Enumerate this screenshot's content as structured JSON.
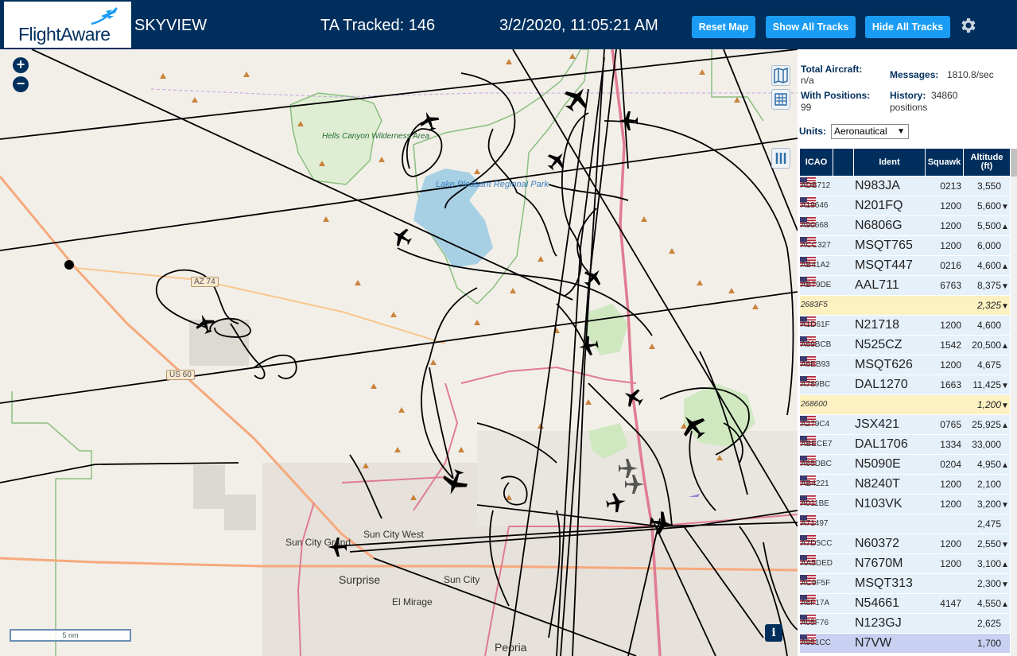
{
  "header": {
    "logo_text": "FlightAware",
    "app_title": "SKYVIEW",
    "tracked": "TA Tracked: 146",
    "datetime": "3/2/2020, 11:05:21 AM",
    "reset_label": "Reset Map",
    "show_label": "Show All Tracks",
    "hide_label": "Hide All Tracks",
    "settings_icon": "gear-icon"
  },
  "map": {
    "zoom_in": "+",
    "zoom_out": "−",
    "scale_label": "5 nm",
    "info_label": "i",
    "place_labels": {
      "hells_canyon": "Hells Canyon Wilderness Area",
      "lake_pleasant": "Lake Pleasant Regional Park",
      "sun_city_west": "Sun City West",
      "sun_city_grand": "Sun City Grand",
      "surprise": "Surprise",
      "sun_city": "Sun City",
      "el_mirage": "El Mirage",
      "peoria": "Peoria"
    },
    "road_shields": {
      "az74": "AZ 74",
      "us60": "US 60"
    },
    "colors": {
      "land": "#f2efe9",
      "water": "#a7d0e4",
      "park_border": "#8bbf80",
      "highway": "#e07c93",
      "track": "#000000"
    }
  },
  "panel": {
    "total_aircraft_label": "Total Aircraft:",
    "total_aircraft_value": "n/a",
    "messages_label": "Messages:",
    "messages_value": "1810.8/sec",
    "with_positions_label": "With Positions:",
    "with_positions_value": "99",
    "history_label": "History:",
    "history_value": "34860",
    "history_unit": "positions",
    "units_label": "Units:",
    "units_value": "Aeronautical",
    "columns": [
      "ICAO",
      "",
      "Ident",
      "Squawk",
      "Altitude (ft)"
    ],
    "rows": [
      {
        "icao": "ADB712",
        "ident": "N983JA",
        "squawk": "0213",
        "alt": "3,550",
        "trend": "",
        "flag": true,
        "state": ""
      },
      {
        "icao": "A19646",
        "ident": "N201FQ",
        "squawk": "1200",
        "alt": "5,600",
        "trend": "▼",
        "flag": true,
        "state": ""
      },
      {
        "icao": "A90668",
        "ident": "N6806G",
        "squawk": "1200",
        "alt": "5,500",
        "trend": "▲",
        "flag": true,
        "state": ""
      },
      {
        "icao": "ACC327",
        "ident": "MSQT765",
        "squawk": "1200",
        "alt": "6,000",
        "trend": "",
        "flag": true,
        "state": ""
      },
      {
        "icao": "AB41A2",
        "ident": "MSQT447",
        "squawk": "0216",
        "alt": "4,600",
        "trend": "▲",
        "flag": true,
        "state": ""
      },
      {
        "icao": "AB79DE",
        "ident": "AAL711",
        "squawk": "6763",
        "alt": "8,375",
        "trend": "▼",
        "flag": true,
        "state": ""
      },
      {
        "icao": "2683F5",
        "ident": "",
        "squawk": "",
        "alt": "2,325",
        "trend": "▼",
        "flag": false,
        "state": "sel"
      },
      {
        "icao": "A1D61F",
        "ident": "N21718",
        "squawk": "1200",
        "alt": "4,600",
        "trend": "",
        "flag": true,
        "state": ""
      },
      {
        "icao": "A69BCB",
        "ident": "N525CZ",
        "squawk": "1542",
        "alt": "20,500",
        "trend": "▲",
        "flag": true,
        "state": ""
      },
      {
        "icao": "A6EB93",
        "ident": "MSQT626",
        "squawk": "1200",
        "alt": "4,675",
        "trend": "",
        "flag": true,
        "state": ""
      },
      {
        "icao": "A789BC",
        "ident": "DAL1270",
        "squawk": "1663",
        "alt": "11,425",
        "trend": "▼",
        "flag": true,
        "state": ""
      },
      {
        "icao": "268600",
        "ident": "",
        "squawk": "",
        "alt": "1,200",
        "trend": "▼",
        "flag": false,
        "state": "sel"
      },
      {
        "icao": "A279C4",
        "ident": "JSX421",
        "squawk": "0765",
        "alt": "25,925",
        "trend": "▲",
        "flag": true,
        "state": ""
      },
      {
        "icao": "ABECE7",
        "ident": "DAL1706",
        "squawk": "1334",
        "alt": "33,000",
        "trend": "",
        "flag": true,
        "state": ""
      },
      {
        "icao": "A65DBC",
        "ident": "N5090E",
        "squawk": "0204",
        "alt": "4,950",
        "trend": "▲",
        "flag": true,
        "state": ""
      },
      {
        "icao": "AB4221",
        "ident": "N8240T",
        "squawk": "1200",
        "alt": "2,100",
        "trend": "",
        "flag": true,
        "state": ""
      },
      {
        "icao": "A011BE",
        "ident": "N103VK",
        "squawk": "1200",
        "alt": "3,200",
        "trend": "▼",
        "flag": true,
        "state": ""
      },
      {
        "icao": "A71497",
        "ident": "",
        "squawk": "",
        "alt": "2,475",
        "trend": "",
        "flag": true,
        "state": ""
      },
      {
        "icao": "A7D5CC",
        "ident": "N60372",
        "squawk": "1200",
        "alt": "2,550",
        "trend": "▼",
        "flag": true,
        "state": ""
      },
      {
        "icao": "AA5DED",
        "ident": "N7670M",
        "squawk": "1200",
        "alt": "3,100",
        "trend": "▲",
        "flag": true,
        "state": ""
      },
      {
        "icao": "AC9F5F",
        "ident": "MSQT313",
        "squawk": "",
        "alt": "2,300",
        "trend": "▼",
        "flag": true,
        "state": ""
      },
      {
        "icao": "A6F17A",
        "ident": "N54661",
        "squawk": "4147",
        "alt": "4,550",
        "trend": "▲",
        "flag": true,
        "state": ""
      },
      {
        "icao": "A05F76",
        "ident": "N123GJ",
        "squawk": "",
        "alt": "2,625",
        "trend": "",
        "flag": true,
        "state": ""
      },
      {
        "icao": "A951CC",
        "ident": "N7VW",
        "squawk": "",
        "alt": "1,700",
        "trend": "",
        "flag": true,
        "state": "hl"
      }
    ]
  }
}
